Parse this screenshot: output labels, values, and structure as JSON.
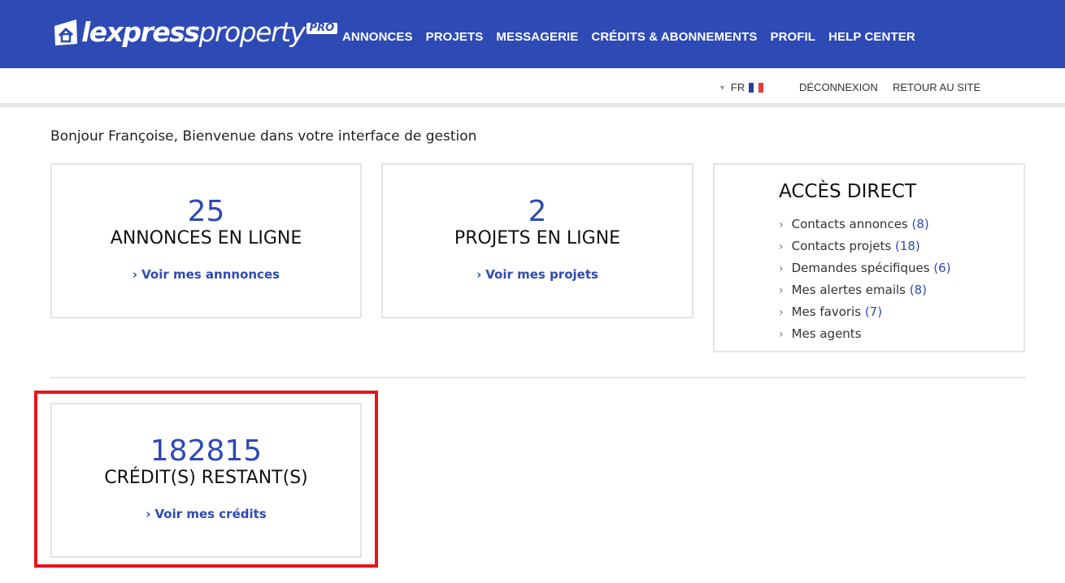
{
  "header": {
    "logo": {
      "light": "lexpress",
      "bold": "property",
      "badge": "PRO"
    },
    "nav": [
      "ANNONCES",
      "PROJETS",
      "MESSAGERIE",
      "CRÉDITS & ABONNEMENTS",
      "PROFIL",
      "HELP CENTER"
    ]
  },
  "subbar": {
    "language": "FR",
    "logout": "DÉCONNEXION",
    "back_to_site": "RETOUR AU SITE"
  },
  "greeting": "Bonjour Françoise, Bienvenue dans votre interface de gestion",
  "cards": {
    "annonces": {
      "count": "25",
      "label": "ANNONCES EN LIGNE",
      "link": "Voir mes annnonces"
    },
    "projets": {
      "count": "2",
      "label": "PROJETS EN LIGNE",
      "link": "Voir mes projets"
    },
    "credits": {
      "count": "182815",
      "label": "CRÉDIT(S) RESTANT(S)",
      "link": "Voir mes crédits"
    }
  },
  "direct_access": {
    "title": "ACCÈS DIRECT",
    "items": [
      {
        "label": "Contacts annonces",
        "count": "(8)"
      },
      {
        "label": "Contacts projets",
        "count": "(18)"
      },
      {
        "label": "Demandes spécifiques",
        "count": "(6)"
      },
      {
        "label": "Mes alertes emails",
        "count": "(8)"
      },
      {
        "label": "Mes favoris",
        "count": "(7)"
      },
      {
        "label": "Mes agents",
        "count": ""
      }
    ]
  },
  "colors": {
    "brand": "#2d4ab5",
    "highlight": "#e8141b"
  }
}
